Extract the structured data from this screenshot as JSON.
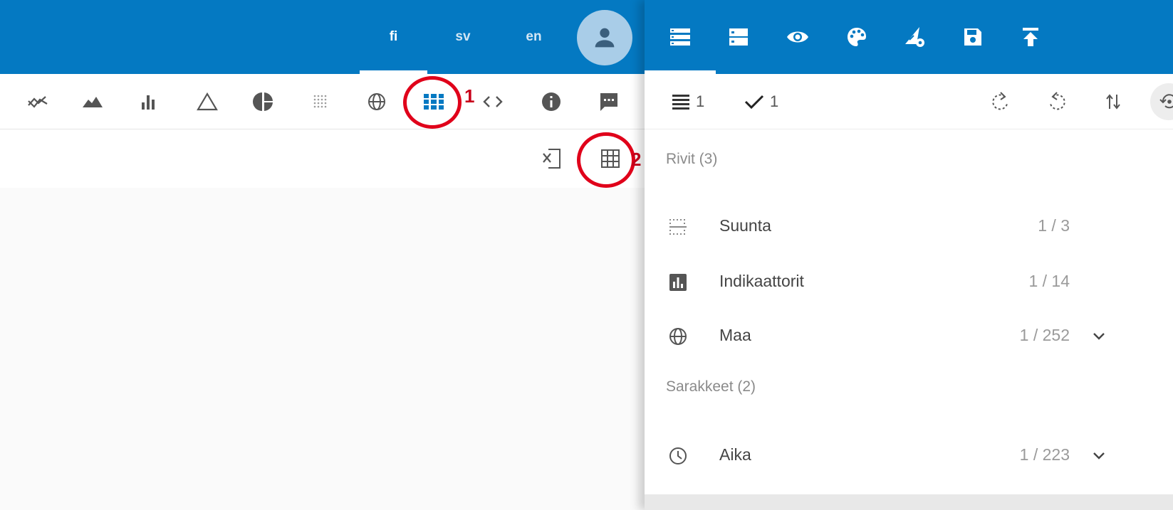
{
  "header": {
    "languages": [
      {
        "code": "fi",
        "active": true
      },
      {
        "code": "sv",
        "active": false
      },
      {
        "code": "en",
        "active": false
      }
    ]
  },
  "chart_toolbar": {
    "icons": [
      "trend-line-icon",
      "area-chart-icon",
      "bar-chart-icon",
      "triangle-icon",
      "pie-chart-icon",
      "dot-matrix-icon",
      "globe-icon",
      "table-view-icon",
      "code-embed-icon",
      "info-icon",
      "comment-icon"
    ],
    "active": "table-view-icon"
  },
  "annotations": {
    "first": "1",
    "second": "2"
  },
  "panel": {
    "tabs": [
      "list-view-icon",
      "dns-icon",
      "eye-icon",
      "palette-icon",
      "format-shapes-settings-icon",
      "save-icon",
      "publish-icon"
    ],
    "active_tab": "list-view-icon",
    "toolbar": {
      "rows_count": "1",
      "checked_count": "1"
    },
    "rows_section": "Rivit (3)",
    "rows": [
      {
        "label": "Suunta",
        "count": "1 / 3",
        "icon": "dotted-grid-icon",
        "expandable": false
      },
      {
        "label": "Indikaattorit",
        "count": "1 / 14",
        "icon": "bar-chart-box-icon",
        "expandable": false
      },
      {
        "label": "Maa",
        "count": "1 / 252",
        "icon": "globe-icon",
        "expandable": true
      }
    ],
    "columns_section": "Sarakkeet (2)",
    "columns": [
      {
        "label": "Aika",
        "count": "1 / 223",
        "icon": "clock-icon",
        "expandable": true
      }
    ]
  },
  "colors": {
    "primary": "#0479c2",
    "annotation": "#e0001a",
    "active_icon": "#0479c2"
  }
}
